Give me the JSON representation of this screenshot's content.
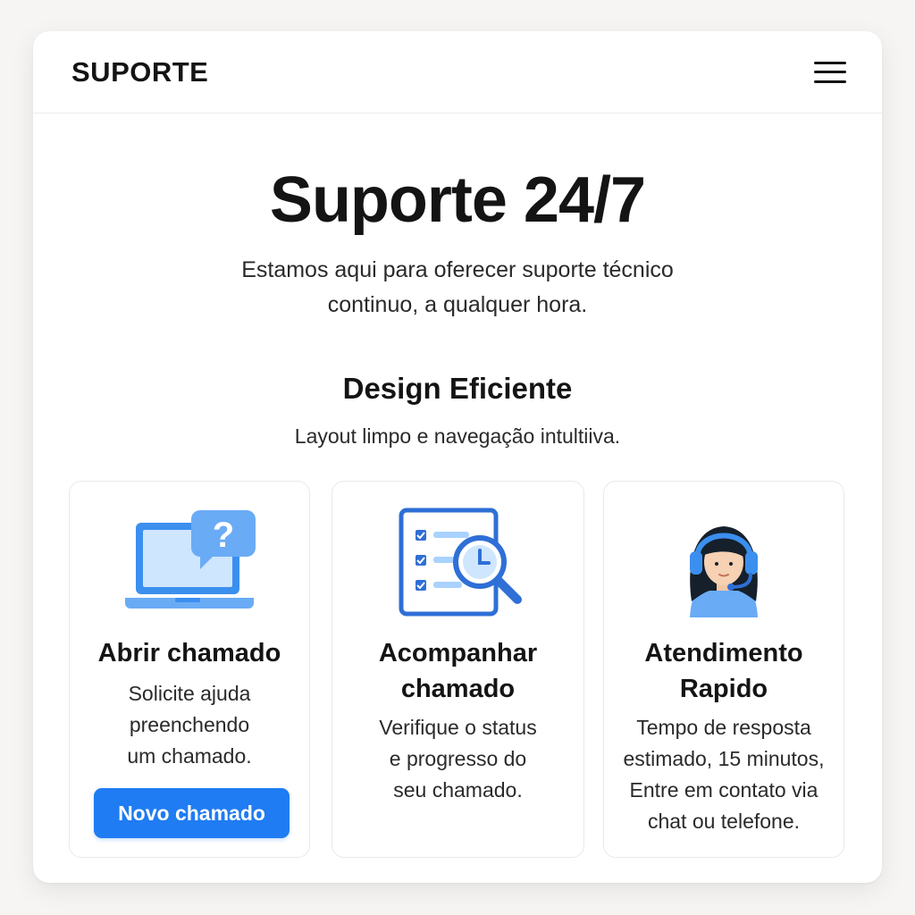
{
  "header": {
    "brand": "SUPORTE",
    "menu_icon": "hamburger-menu-icon"
  },
  "hero": {
    "title": "Suporte 24/7",
    "subtitle": "Estamos aqui para oferecer suporte técnico\ncontinuo, a qualquer hora."
  },
  "section": {
    "title": "Design Eficiente",
    "subtitle": "Layout limpo e navegação intultiiva."
  },
  "cards": [
    {
      "icon": "laptop-question-icon",
      "title": "Abrir chamado",
      "description": "Solicite ajuda\npreenchendo\num chamado.",
      "button_label": "Novo chamado"
    },
    {
      "icon": "checklist-clock-search-icon",
      "title": "Acompanhar chamado",
      "description": "Verifique o status\ne progresso do\nseu chamado."
    },
    {
      "icon": "support-agent-headset-icon",
      "title": "Atendimento Rapido",
      "description": "Tempo de resposta\nestimado, 15 minutos,\nEntre em contato via\nchat ou telefone."
    }
  ],
  "colors": {
    "accent": "#1f7cf2",
    "icon_blue": "#3b8fef",
    "icon_light": "#cfe6ff",
    "background": "#f6f5f3"
  }
}
